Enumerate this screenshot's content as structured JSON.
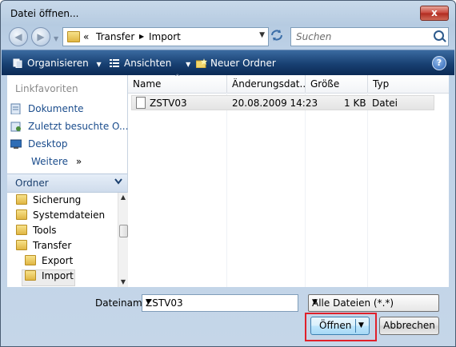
{
  "window": {
    "title": "Datei öffnen...",
    "close_label": "x"
  },
  "nav": {
    "back_glyph": "◀",
    "forward_glyph": "▶",
    "breadcrumb_prefix": "«",
    "path": [
      "Transfer",
      "Import"
    ],
    "path_sep": "▶",
    "search_placeholder": "Suchen"
  },
  "toolbar": {
    "organize_label": "Organisieren",
    "views_label": "Ansichten",
    "new_folder_label": "Neuer Ordner",
    "help_label": "?",
    "dropdown_glyph": "▼"
  },
  "sidebar": {
    "favorites_heading": "Linkfavoriten",
    "favorites": [
      "Dokumente",
      "Zuletzt besuchte O...",
      "Desktop",
      "Weitere"
    ],
    "more_glyph": "»",
    "folders_heading": "Ordner",
    "folders": [
      "Sicherung",
      "Systemdateien",
      "Tools",
      "Transfer",
      "Export",
      "Import"
    ],
    "selected_folder": "Import"
  },
  "file_list": {
    "columns": [
      "Name",
      "Änderungsdat...",
      "Größe",
      "Typ"
    ],
    "rows": [
      {
        "name": "ZSTV03",
        "date": "20.08.2009 14:23",
        "size": "1 KB",
        "type": "Datei"
      }
    ]
  },
  "footer": {
    "filename_label": "Dateiname:",
    "filename_value": "ZSTV03",
    "filetype_value": "Alle Dateien (*.*)",
    "open_label": "Öffnen",
    "cancel_label": "Abbrechen"
  },
  "colors": {
    "toolbar_dark": "#184072",
    "link_blue": "#1a4c8c",
    "highlight_red": "#e0202a"
  }
}
